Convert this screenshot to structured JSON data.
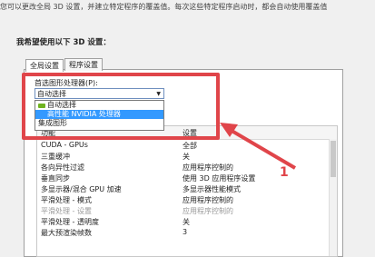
{
  "intro_text": "您可以更改全局 3D 设置，并建立特定程序的覆盖值。每次这些特定程序启动时，都会自动使用覆盖值",
  "section_title": "我希望使用以下 3D 设置：",
  "tabs": [
    {
      "label": "全局设置",
      "active": true
    },
    {
      "label": "程序设置",
      "active": false
    }
  ],
  "preferred_label": "首选图形处理器(P):",
  "select_value": "自动选择",
  "dropdown_options": [
    {
      "label": "自动选择",
      "icon": "nvidia-gpu-icon"
    },
    {
      "label": "高性能 NVIDIA 处理器",
      "selected": true
    },
    {
      "label": "集成图形"
    }
  ],
  "table_header": {
    "feature": "功能",
    "setting": "设置"
  },
  "rows": [
    {
      "feature": "CUDA - GPUs",
      "setting": "全部"
    },
    {
      "feature": "三重缓冲",
      "setting": "关"
    },
    {
      "feature": "各向异性过滤",
      "setting": "应用程序控制的"
    },
    {
      "feature": "垂直同步",
      "setting": "使用 3D 应用程序设置"
    },
    {
      "feature": "多显示器/混合 GPU 加速",
      "setting": "多显示器性能模式"
    },
    {
      "feature": "平滑处理 - 模式",
      "setting": "应用程序控制的"
    },
    {
      "feature": "平滑处理 - 设置",
      "setting": "应用程序控制的",
      "disabled": true
    },
    {
      "feature": "平滑处理 - 透明度",
      "setting": "关"
    },
    {
      "feature": "最大预渲染帧数",
      "setting": "3"
    }
  ],
  "annotation_number": "1",
  "colors": {
    "highlight": "#e0454a",
    "selection": "#3399ff"
  }
}
